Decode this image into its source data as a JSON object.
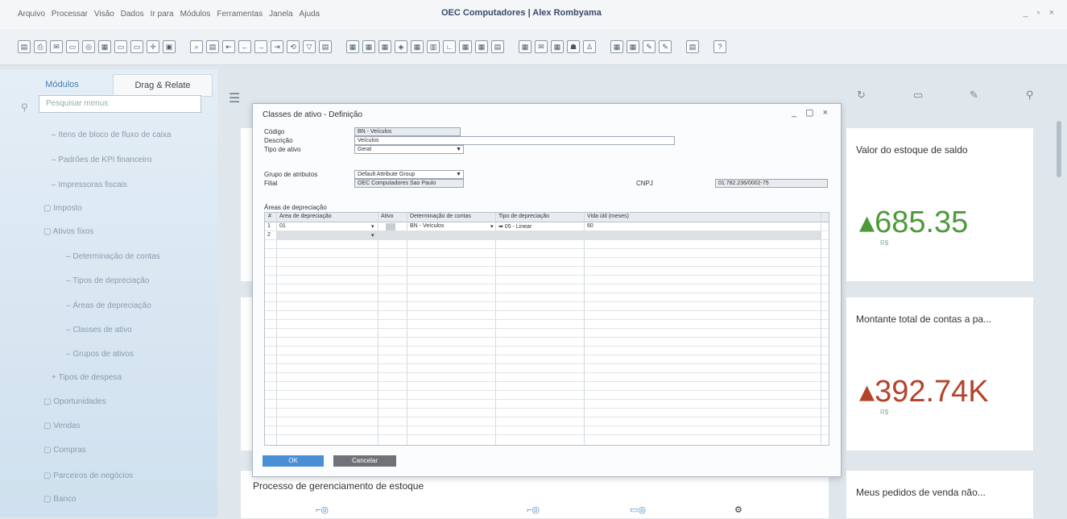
{
  "menu": [
    "Arquivo",
    "Processar",
    "Visão",
    "Dados",
    "Ir para",
    "Módulos",
    "Ferramentas",
    "Janela",
    "Ajuda"
  ],
  "window_title": "OEC Computadores | Alex Rombyama",
  "window_controls": "_ ▫ ×",
  "sidebar": {
    "tabs": [
      "Módulos",
      "Drag & Relate"
    ],
    "search_placeholder": "Pesquisar menus",
    "items": [
      {
        "label": "Itens de bloco de fluxo de caixa",
        "icon": "–"
      },
      {
        "label": "Padrões de KPI financeiro",
        "icon": "–"
      },
      {
        "label": "Impressoras fiscais",
        "icon": "–"
      },
      {
        "label": "Imposto",
        "icon": "▢"
      },
      {
        "label": "Ativos fixos",
        "icon": "▢"
      },
      {
        "label": "Determinação de contas",
        "icon": "–"
      },
      {
        "label": "Tipos de depreciação",
        "icon": "–"
      },
      {
        "label": "Áreas de depreciação",
        "icon": "–"
      },
      {
        "label": "Classes de ativo",
        "icon": "–"
      },
      {
        "label": "Grupos de ativos",
        "icon": "–"
      },
      {
        "label": "Tipos de despesa",
        "icon": "+"
      },
      {
        "label": "Oportunidades",
        "icon": "▢"
      },
      {
        "label": "Vendas",
        "icon": "▢"
      },
      {
        "label": "Compras",
        "icon": "▢"
      },
      {
        "label": "Parceiros de negócios",
        "icon": "▢"
      },
      {
        "label": "Banco",
        "icon": "▢"
      }
    ]
  },
  "dialog": {
    "title": "Classes de ativo - Definição",
    "controls": "_ ▢ ×",
    "fields": {
      "codigo_label": "Código",
      "codigo_value": "BN - Veículos",
      "descricao_label": "Descrição",
      "descricao_value": "Veículos",
      "tipo_label": "Tipo de ativo",
      "tipo_value": "Geral",
      "grupo_label": "Grupo de atributos",
      "grupo_value": "Default Attribute Group",
      "filial_label": "Filial",
      "filial_value": "OEC Computadores Sao Paulo",
      "cnpj_label": "CNPJ",
      "cnpj_value": "01.782.236/0002-75"
    },
    "grid_title": "Áreas de depreciação",
    "grid_headers": [
      "#",
      "Área de depreciação",
      "Ativo",
      "Determinação de contas",
      "Tipo de depreciação",
      "Vida útil (meses)"
    ],
    "row1": [
      "1",
      "01",
      "",
      "BN - Veículos",
      "➡ 05 - Linear",
      "60"
    ],
    "row2": [
      "2",
      "",
      "",
      "",
      "",
      ""
    ],
    "ok_label": "OK",
    "cancel_label": "Cancelar"
  },
  "cards": [
    {
      "title": "Valor do estoque de saldo",
      "value": "685.35",
      "currency": "R$",
      "color": "#4e9a3a"
    },
    {
      "title": "Montante total de contas a pa...",
      "value": "392.74K",
      "currency": "R$",
      "color": "#b5432c"
    },
    {
      "title": "Meus pedidos de venda não...",
      "value": "",
      "currency": "",
      "color": ""
    }
  ],
  "process_title": "Processo de gerenciamento de estoque"
}
